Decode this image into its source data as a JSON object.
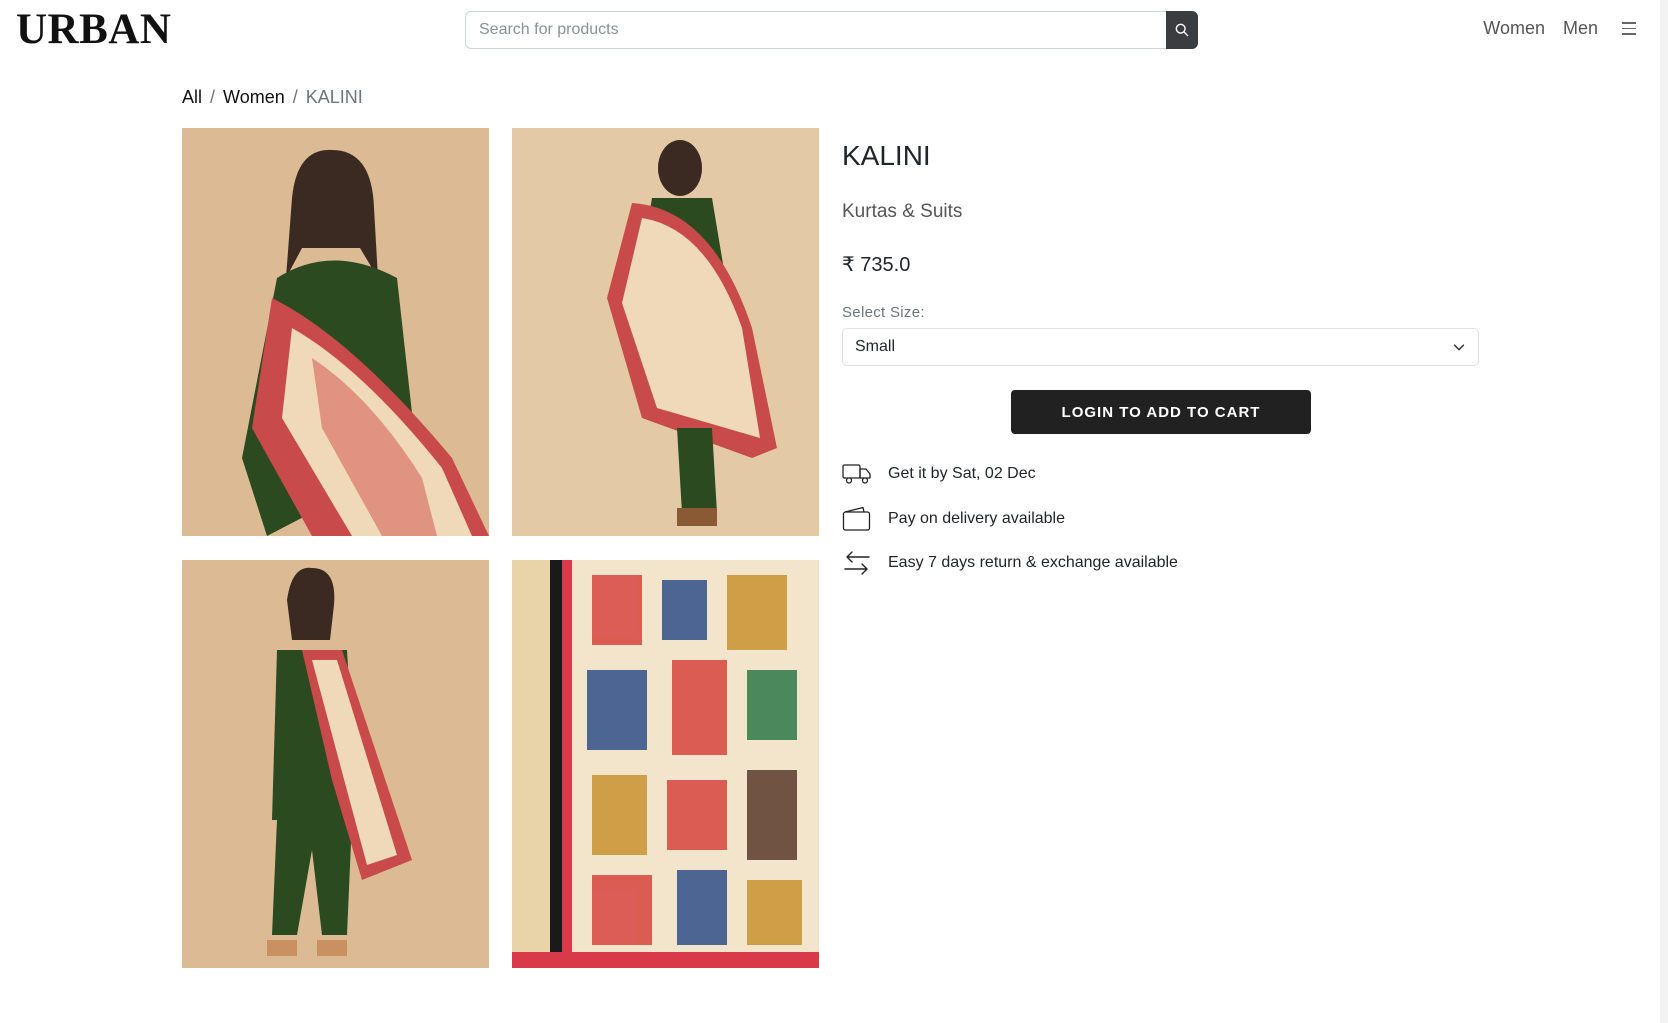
{
  "header": {
    "logo": "URBAN",
    "search_placeholder": "Search for products",
    "nav": [
      "Women",
      "Men"
    ]
  },
  "breadcrumb": {
    "items": [
      "All",
      "Women"
    ],
    "current": "KALINI",
    "separator": "/"
  },
  "product": {
    "title": "KALINI",
    "category": "Kurtas & Suits",
    "price": "₹ 735.0",
    "size_label": "Select Size:",
    "size_selected": "Small",
    "cart_button": "LOGIN TO ADD TO CART",
    "features": [
      {
        "icon": "truck-icon",
        "text": "Get it by Sat, 02 Dec"
      },
      {
        "icon": "wallet-icon",
        "text": "Pay on delivery available"
      },
      {
        "icon": "exchange-icon",
        "text": "Easy 7 days return & exchange available"
      }
    ]
  },
  "colors": {
    "button_bg": "#212121",
    "search_button": "#3a3d40",
    "image_bg": "#e6c9a5",
    "kurta_green": "#2c4a1f",
    "dupatta_red": "#c84a4a"
  }
}
